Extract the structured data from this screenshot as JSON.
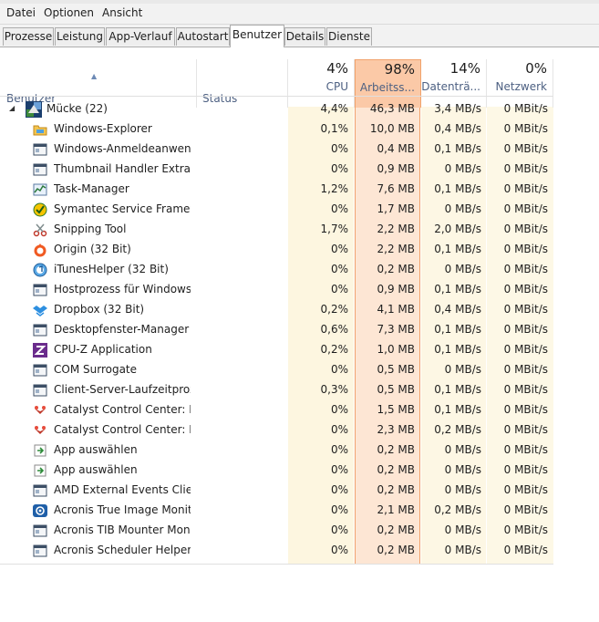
{
  "menu": [
    "Datei",
    "Optionen",
    "Ansicht"
  ],
  "tabs": [
    {
      "label": "Prozesse",
      "active": false
    },
    {
      "label": "Leistung",
      "active": false
    },
    {
      "label": "App-Verlauf",
      "active": false
    },
    {
      "label": "Autostart",
      "active": false
    },
    {
      "label": "Benutzer",
      "active": true
    },
    {
      "label": "Details",
      "active": false
    },
    {
      "label": "Dienste",
      "active": false
    }
  ],
  "columns": {
    "benutzer": "Benutzer",
    "status": "Status",
    "cpu": {
      "pct": "4%",
      "label": "CPU"
    },
    "mem": {
      "pct": "98%",
      "label": "Arbeitss..."
    },
    "disk": {
      "pct": "14%",
      "label": "Datenträ..."
    },
    "net": {
      "pct": "0%",
      "label": "Netzwerk"
    }
  },
  "colors": {
    "cpu_bg": "#fdf6e0",
    "mem_bg": "#fde6d4",
    "mem_header_bg": "#fbc9a7",
    "mem_border": "#f1a26b",
    "disk_bg": "#fdf7e4",
    "net_bg": "#fdf8e6"
  },
  "user": {
    "name": "Mücke (22)",
    "icon": "user-tile-icon",
    "cpu": "4,4%",
    "mem": "46,3 MB",
    "disk": "3,4 MB/s",
    "net": "0 MBit/s"
  },
  "processes": [
    {
      "name": "Windows-Explorer",
      "icon": "folder-icon",
      "cpu": "0,1%",
      "mem": "10,0 MB",
      "disk": "0,4 MB/s",
      "net": "0 MBit/s"
    },
    {
      "name": "Windows-Anmeldeanwen...",
      "icon": "window-icon",
      "cpu": "0%",
      "mem": "0,4 MB",
      "disk": "0,1 MB/s",
      "net": "0 MBit/s"
    },
    {
      "name": "Thumbnail Handler Extract...",
      "icon": "window-icon",
      "cpu": "0%",
      "mem": "0,9 MB",
      "disk": "0 MB/s",
      "net": "0 MBit/s"
    },
    {
      "name": "Task-Manager",
      "icon": "task-manager-icon",
      "cpu": "1,2%",
      "mem": "7,6 MB",
      "disk": "0,1 MB/s",
      "net": "0 MBit/s"
    },
    {
      "name": "Symantec Service Framew...",
      "icon": "symantec-icon",
      "cpu": "0%",
      "mem": "1,7 MB",
      "disk": "0 MB/s",
      "net": "0 MBit/s"
    },
    {
      "name": "Snipping Tool",
      "icon": "scissors-icon",
      "cpu": "1,7%",
      "mem": "2,2 MB",
      "disk": "2,0 MB/s",
      "net": "0 MBit/s"
    },
    {
      "name": "Origin (32 Bit)",
      "icon": "origin-icon",
      "cpu": "0%",
      "mem": "2,2 MB",
      "disk": "0,1 MB/s",
      "net": "0 MBit/s"
    },
    {
      "name": "iTunesHelper (32 Bit)",
      "icon": "itunes-icon",
      "cpu": "0%",
      "mem": "0,2 MB",
      "disk": "0 MB/s",
      "net": "0 MBit/s"
    },
    {
      "name": "Hostprozess für Windows-...",
      "icon": "window-icon",
      "cpu": "0%",
      "mem": "0,9 MB",
      "disk": "0,1 MB/s",
      "net": "0 MBit/s"
    },
    {
      "name": "Dropbox (32 Bit)",
      "icon": "dropbox-icon",
      "cpu": "0,2%",
      "mem": "4,1 MB",
      "disk": "0,4 MB/s",
      "net": "0 MBit/s"
    },
    {
      "name": "Desktopfenster-Manager",
      "icon": "window-icon",
      "cpu": "0,6%",
      "mem": "7,3 MB",
      "disk": "0,1 MB/s",
      "net": "0 MBit/s"
    },
    {
      "name": "CPU-Z Application",
      "icon": "cpuz-icon",
      "cpu": "0,2%",
      "mem": "1,0 MB",
      "disk": "0,1 MB/s",
      "net": "0 MBit/s"
    },
    {
      "name": "COM Surrogate",
      "icon": "window-icon",
      "cpu": "0%",
      "mem": "0,5 MB",
      "disk": "0 MB/s",
      "net": "0 MBit/s"
    },
    {
      "name": "Client-Server-Laufzeitproz...",
      "icon": "window-icon",
      "cpu": "0,3%",
      "mem": "0,5 MB",
      "disk": "0,1 MB/s",
      "net": "0 MBit/s"
    },
    {
      "name": "Catalyst Control Center: M...",
      "icon": "catalyst-icon",
      "cpu": "0%",
      "mem": "1,5 MB",
      "disk": "0,1 MB/s",
      "net": "0 MBit/s"
    },
    {
      "name": "Catalyst Control Center: H...",
      "icon": "catalyst-icon",
      "cpu": "0%",
      "mem": "2,3 MB",
      "disk": "0,2 MB/s",
      "net": "0 MBit/s"
    },
    {
      "name": "App auswählen",
      "icon": "app-chooser-icon",
      "cpu": "0%",
      "mem": "0,2 MB",
      "disk": "0 MB/s",
      "net": "0 MBit/s"
    },
    {
      "name": "App auswählen",
      "icon": "app-chooser-icon",
      "cpu": "0%",
      "mem": "0,2 MB",
      "disk": "0 MB/s",
      "net": "0 MBit/s"
    },
    {
      "name": "AMD External Events Client...",
      "icon": "window-icon",
      "cpu": "0%",
      "mem": "0,2 MB",
      "disk": "0 MB/s",
      "net": "0 MBit/s"
    },
    {
      "name": "Acronis True Image Monit...",
      "icon": "acronis-icon",
      "cpu": "0%",
      "mem": "2,1 MB",
      "disk": "0,2 MB/s",
      "net": "0 MBit/s"
    },
    {
      "name": "Acronis TIB Mounter Moni...",
      "icon": "window-icon",
      "cpu": "0%",
      "mem": "0,2 MB",
      "disk": "0 MB/s",
      "net": "0 MBit/s"
    },
    {
      "name": "Acronis Scheduler Helper",
      "icon": "window-icon",
      "cpu": "0%",
      "mem": "0,2 MB",
      "disk": "0 MB/s",
      "net": "0 MBit/s"
    }
  ]
}
